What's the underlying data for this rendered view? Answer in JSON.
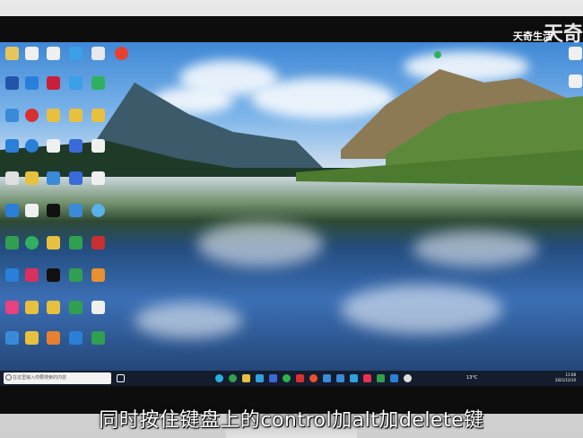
{
  "watermark": {
    "brand": "天奇生活",
    "brand_partial": "天奇"
  },
  "subtitle": "同时按住键盘上的control加alt加delete键",
  "taskbar": {
    "search_placeholder": "在这里输入你要搜索的内容",
    "clock_time": "11:08",
    "clock_date": "2021/12/10",
    "weather": "13°C"
  },
  "colors": {
    "taskbar": "#141a28",
    "sky": "#3f88d6",
    "lake": "#244d80",
    "subtitle": "#ffffff"
  }
}
